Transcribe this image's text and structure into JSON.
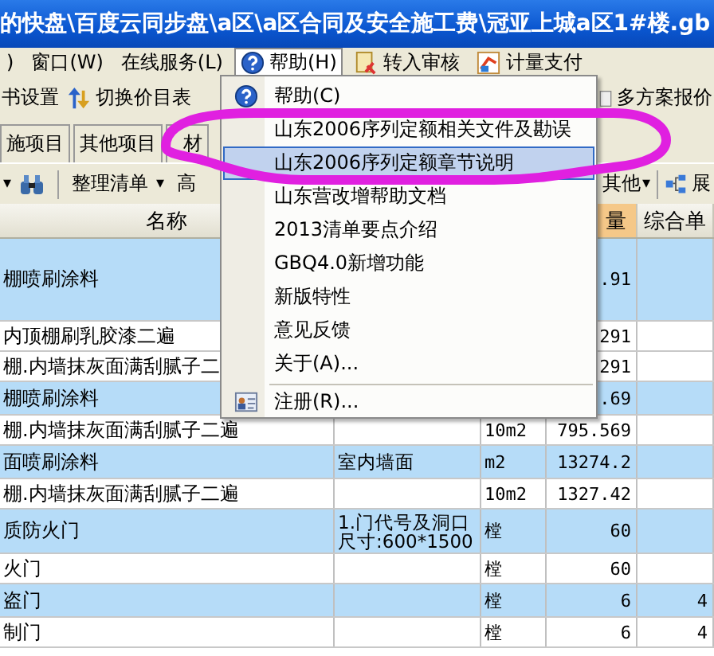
{
  "window": {
    "title": "的快盘\\百度云同步盘\\a区\\a区合同及安全施工费\\冠亚上城a区1#楼.gb"
  },
  "menu_bar": [
    {
      "label": ")",
      "kind": "plain",
      "selected": false
    },
    {
      "label": "窗口(W)",
      "kind": "plain",
      "selected": false
    },
    {
      "label": "在线服务(L)",
      "kind": "plain",
      "selected": false
    },
    {
      "label": "帮助(H)",
      "kind": "help",
      "selected": true
    },
    {
      "label": "转入审核",
      "kind": "review",
      "selected": false
    },
    {
      "label": "计量支付",
      "kind": "pay",
      "selected": false
    }
  ],
  "toolbar": {
    "left": [
      {
        "label": "书设置",
        "kind": "plain"
      },
      {
        "label": "切换价目表",
        "kind": "switch"
      }
    ],
    "right": [
      {
        "label": "多方案报价",
        "kind": "scheme"
      }
    ]
  },
  "tabs": [
    {
      "label": "施项目",
      "selected": false
    },
    {
      "label": "其他项目",
      "selected": false
    },
    {
      "label": "材",
      "selected": false
    }
  ],
  "toolbar2": {
    "left": [
      {
        "label": "▾",
        "kind": "caret"
      },
      {
        "kind": "binoculars"
      },
      {
        "kind": "separator"
      },
      {
        "label": "整理清单",
        "kind": "plain"
      },
      {
        "label": "▾",
        "kind": "caret"
      },
      {
        "label": "高",
        "kind": "plain"
      }
    ],
    "right": [
      {
        "label": "其他",
        "kind": "plain"
      },
      {
        "label": "▾",
        "kind": "caret"
      },
      {
        "kind": "separator"
      },
      {
        "label": "展",
        "kind": "expand"
      }
    ]
  },
  "table": {
    "columns": [
      "名称",
      "量",
      "综合单"
    ],
    "rows": [
      {
        "kind": "bill",
        "name": "棚喷刷涂料",
        "quantity": ".91"
      },
      {
        "kind": "quota",
        "name": "内顶棚刷乳胶漆二遍",
        "quantity": "291"
      },
      {
        "kind": "quota",
        "name": "棚.内墙抹灰面满刮腻子二",
        "quantity": "291"
      },
      {
        "kind": "bill",
        "name": "棚喷刷涂料",
        "quantity": ".69"
      },
      {
        "kind": "quota",
        "name": "棚.内墙抹灰面满刮腻子二遍",
        "unit": "10m2",
        "quantity": "795.569"
      },
      {
        "kind": "bill",
        "name": "面喷刷涂料",
        "feature": "室内墙面",
        "unit": "m2",
        "quantity": "13274.2"
      },
      {
        "kind": "quota",
        "name": "棚.内墙抹灰面满刮腻子二遍",
        "unit": "10m2",
        "quantity": "1327.42"
      },
      {
        "kind": "bill",
        "name": "质防火门",
        "feature": "1.门代号及洞口尺寸:600*1500",
        "unit": "樘",
        "quantity": "60"
      },
      {
        "kind": "quota",
        "name": "火门",
        "unit": "樘",
        "quantity": "60"
      },
      {
        "kind": "bill",
        "name": "盗门",
        "unit": "樘",
        "quantity": "6",
        "price": "4"
      },
      {
        "kind": "quota",
        "name": "制门",
        "unit": "樘",
        "quantity": "6",
        "price": "4"
      }
    ]
  },
  "help_menu": [
    {
      "label": "帮助(C)",
      "kind": "help",
      "selected": false
    },
    {
      "label": "山东2006序列定额相关文件及勘误",
      "kind": "plain",
      "selected": false
    },
    {
      "label": "山东2006序列定额章节说明",
      "kind": "plain",
      "selected": true
    },
    {
      "label": "山东营改增帮助文档",
      "kind": "plain",
      "selected": false
    },
    {
      "label": "2013清单要点介绍",
      "kind": "plain",
      "selected": false
    },
    {
      "label": "GBQ4.0新增功能",
      "kind": "plain",
      "selected": false
    },
    {
      "label": "新版特性",
      "kind": "plain",
      "selected": false
    },
    {
      "label": "意见反馈",
      "kind": "plain",
      "selected": false
    },
    {
      "label": "关于(A)...",
      "kind": "plain",
      "selected": false
    },
    {
      "kind": "separator"
    },
    {
      "label": "注册(R)...",
      "kind": "card",
      "selected": false
    }
  ]
}
